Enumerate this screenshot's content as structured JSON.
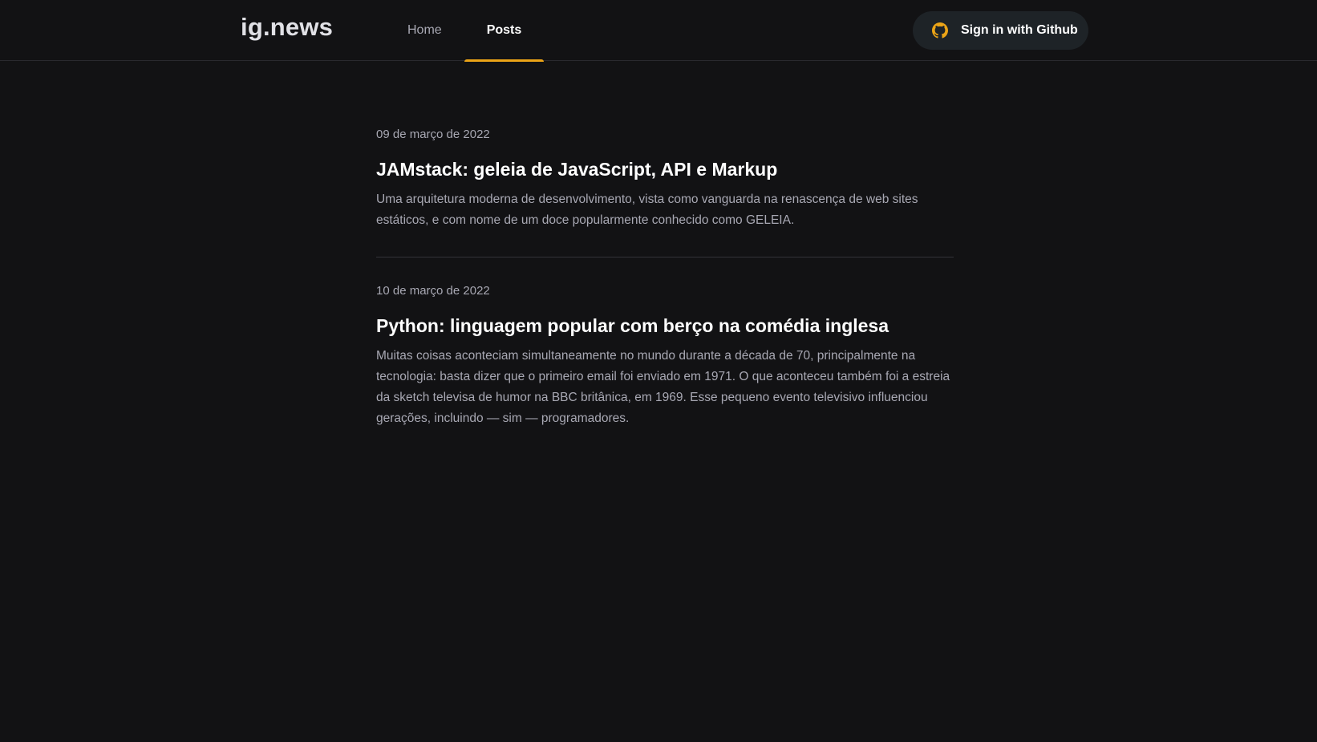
{
  "header": {
    "logo": "ig.news",
    "nav": [
      {
        "label": "Home",
        "active": false
      },
      {
        "label": "Posts",
        "active": true
      }
    ],
    "sign_in": {
      "label": "Sign in with Github",
      "icon": "github-icon",
      "icon_color": "#eba417"
    }
  },
  "colors": {
    "background": "#121214",
    "accent": "#eba417",
    "button_bg": "#1e2327",
    "text_muted": "#a8a8b3",
    "divider": "#323238"
  },
  "posts": [
    {
      "date": "09 de março de 2022",
      "title": "JAMstack: geleia de JavaScript, API e Markup",
      "excerpt": "Uma arquitetura moderna de desenvolvimento, vista como vanguarda na renascença de web sites estáticos, e com nome de um doce popularmente conhecido como GELEIA."
    },
    {
      "date": "10 de março de 2022",
      "title": "Python: linguagem popular com berço na comédia inglesa",
      "excerpt": "Muitas coisas aconteciam simultaneamente no mundo durante a década de 70, principalmente na tecnologia: basta dizer que o primeiro email foi enviado em 1971. O que aconteceu também foi a estreia da sketch televisa de humor na BBC britânica, em 1969. Esse pequeno evento televisivo influenciou gerações, incluindo — sim — programadores."
    }
  ]
}
